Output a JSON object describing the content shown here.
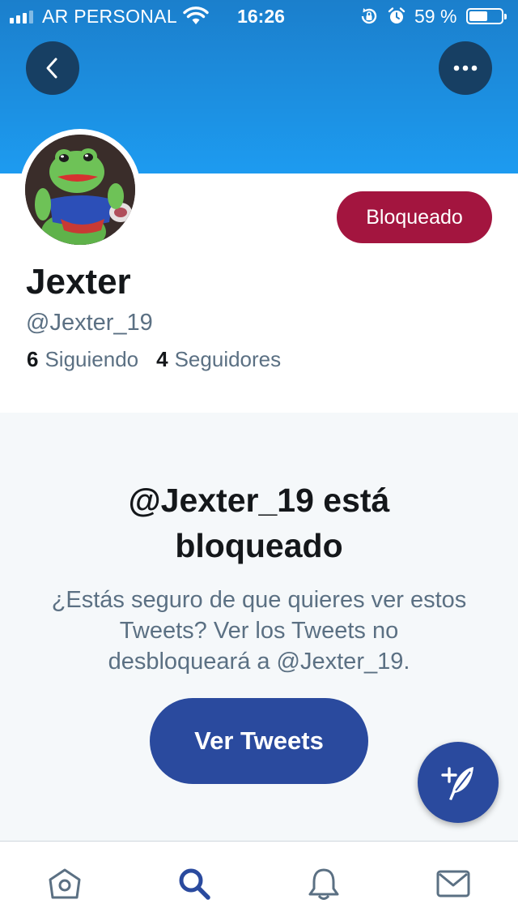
{
  "status_bar": {
    "carrier": "AR PERSONAL",
    "time": "16:26",
    "battery_percent": "59 %",
    "battery_level": 0.59
  },
  "header": {
    "back_icon": "chevron-left-icon",
    "more_icon": "ellipsis-icon"
  },
  "profile": {
    "name": "Jexter",
    "handle": "@Jexter_19",
    "following_count": "6",
    "following_label": "Siguiendo",
    "followers_count": "4",
    "followers_label": "Seguidores",
    "blocked_button": "Bloqueado"
  },
  "blocked_panel": {
    "title": "@Jexter_19 está bloqueado",
    "message": "¿Estás seguro de que quieres ver estos Tweets? Ver los Tweets no desbloqueará a @Jexter_19.",
    "button": "Ver Tweets"
  },
  "fab": {
    "icon": "compose-tweet-icon"
  },
  "tab_bar": {
    "items": [
      {
        "id": "home",
        "icon": "home-icon"
      },
      {
        "id": "search",
        "icon": "search-icon",
        "active": true
      },
      {
        "id": "notifications",
        "icon": "bell-icon"
      },
      {
        "id": "messages",
        "icon": "mail-icon"
      }
    ]
  },
  "colors": {
    "banner": "#1d9bf0",
    "blocked_button": "#a3153f",
    "primary_button": "#2a4a9e",
    "active_tab": "#2a4a9e",
    "panel_background": "#f5f8fa"
  }
}
